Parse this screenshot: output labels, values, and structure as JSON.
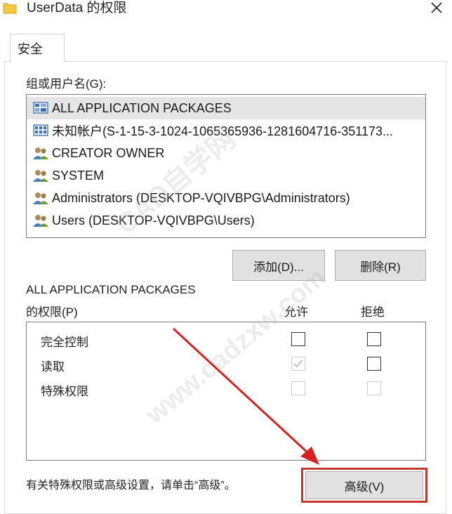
{
  "window": {
    "title": "UserData 的权限",
    "close_glyph": "✕"
  },
  "tabs": [
    {
      "label": "安全"
    }
  ],
  "groups": {
    "label": "组或用户名(G):",
    "items": [
      {
        "label": "ALL APPLICATION PACKAGES",
        "icon": "app-packages-icon",
        "selected": true
      },
      {
        "label": "未知帐户(S-1-15-3-1024-1065365936-1281604716-351173...",
        "icon": "unknown-account-icon",
        "selected": false
      },
      {
        "label": "CREATOR OWNER",
        "icon": "users-icon",
        "selected": false
      },
      {
        "label": "SYSTEM",
        "icon": "users-icon",
        "selected": false
      },
      {
        "label": "Administrators (DESKTOP-VQIVBPG\\Administrators)",
        "icon": "users-icon",
        "selected": false
      },
      {
        "label": "Users (DESKTOP-VQIVBPG\\Users)",
        "icon": "users-icon",
        "selected": false
      }
    ],
    "add_label": "添加(D)...",
    "remove_label": "删除(R)"
  },
  "permissions": {
    "for_label": "ALL APPLICATION PACKAGES",
    "title_label": "的权限(P)",
    "allow_header": "允许",
    "deny_header": "拒绝",
    "rows": [
      {
        "name": "完全控制",
        "allow": "unchecked",
        "deny": "unchecked"
      },
      {
        "name": "读取",
        "allow": "checked-disabled",
        "deny": "unchecked"
      },
      {
        "name": "特殊权限",
        "allow": "unchecked-disabled",
        "deny": "unchecked-disabled"
      }
    ]
  },
  "footer": {
    "hint": "有关特殊权限或高级设置，请单击“高级”。",
    "advanced_label": "高级(V)"
  },
  "watermark": {
    "line1": "CAD自学网",
    "line2": "www.cadzxw.com"
  },
  "colors": {
    "highlight": "#c0392b",
    "selection": "#e5e5e5",
    "button": "#e1e1e1",
    "folder": "#f4c842"
  }
}
